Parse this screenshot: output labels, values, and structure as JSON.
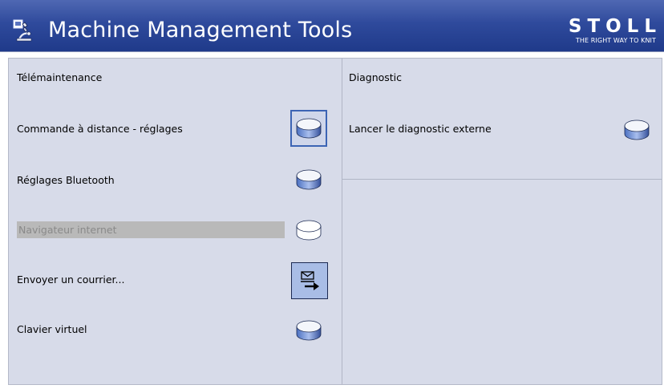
{
  "header": {
    "title": "Machine Management Tools",
    "brand_name": "STOLL",
    "brand_tagline": "THE RIGHT WAY TO KNIT",
    "icon": "microscope-icon"
  },
  "colors": {
    "header_bg": "#2f4a9c",
    "panel_bg": "#d7dbe9",
    "disabled_bg": "#b9b9b9",
    "mail_button_bg": "#a9bde6",
    "focus_border": "#3c64b4"
  },
  "left_panel": {
    "title": "Télémaintenance",
    "items": [
      {
        "label": "Commande à distance - réglages",
        "icon": "disc-icon",
        "state": "focused"
      },
      {
        "label": "Réglages Bluetooth",
        "icon": "disc-icon",
        "state": "normal"
      },
      {
        "label": "Navigateur internet",
        "icon": "disc-icon",
        "state": "disabled"
      },
      {
        "label": "Envoyer un courrier...",
        "icon": "send-mail-icon",
        "state": "normal"
      },
      {
        "label": "Clavier virtuel",
        "icon": "disc-icon",
        "state": "normal"
      }
    ]
  },
  "right_panel": {
    "title": "Diagnostic",
    "items": [
      {
        "label": "Lancer le diagnostic externe",
        "icon": "disc-icon",
        "state": "normal"
      }
    ]
  }
}
